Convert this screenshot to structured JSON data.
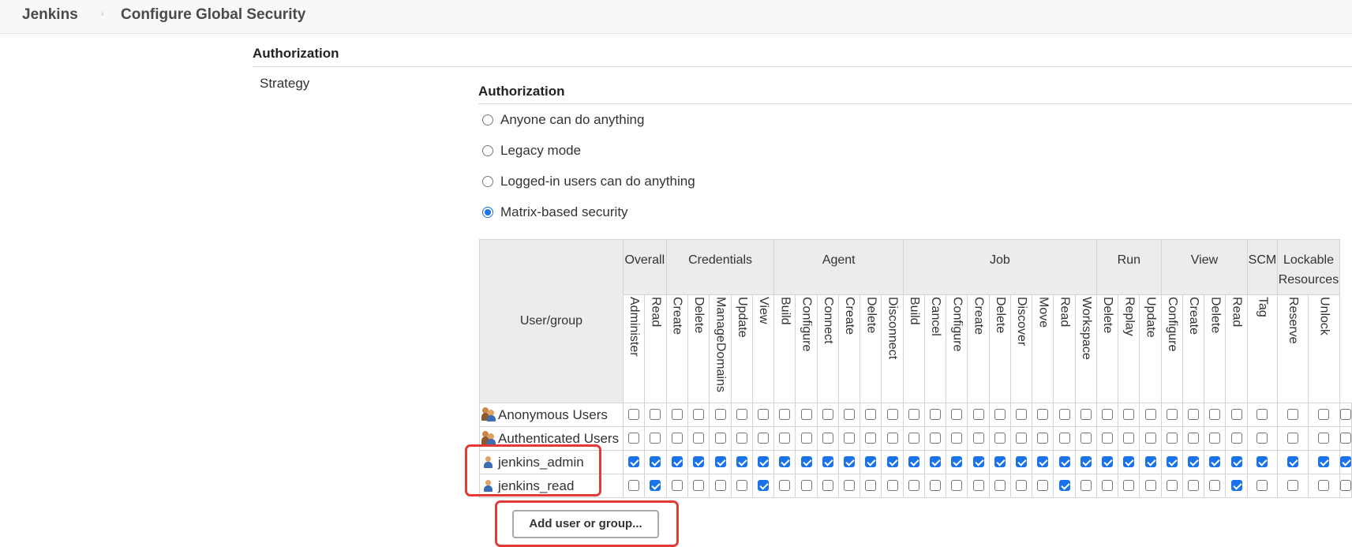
{
  "breadcrumb": {
    "home": "Jenkins",
    "separator": "›",
    "page": "Configure Global Security"
  },
  "authorization_section": {
    "title": "Authorization",
    "strategy_label": "Strategy",
    "subtitle": "Authorization"
  },
  "strategies": [
    {
      "label": "Anyone can do anything",
      "selected": false
    },
    {
      "label": "Legacy mode",
      "selected": false
    },
    {
      "label": "Logged-in users can do anything",
      "selected": false
    },
    {
      "label": "Matrix-based security",
      "selected": true
    }
  ],
  "matrix": {
    "user_group_header": "User/group",
    "groups": [
      {
        "label": "Overall",
        "permissions": [
          "Administer",
          "Read"
        ]
      },
      {
        "label": "Credentials",
        "permissions": [
          "Create",
          "Delete",
          "ManageDomains",
          "Update",
          "View"
        ]
      },
      {
        "label": "Agent",
        "permissions": [
          "Build",
          "Configure",
          "Connect",
          "Create",
          "Delete",
          "Disconnect"
        ]
      },
      {
        "label": "Job",
        "permissions": [
          "Build",
          "Cancel",
          "Configure",
          "Create",
          "Delete",
          "Discover",
          "Move",
          "Read",
          "Workspace"
        ]
      },
      {
        "label": "Run",
        "permissions": [
          "Delete",
          "Replay",
          "Update"
        ]
      },
      {
        "label": "View",
        "permissions": [
          "Configure",
          "Create",
          "Delete",
          "Read"
        ]
      },
      {
        "label": "SCM",
        "permissions": [
          "Tag"
        ]
      },
      {
        "label": "Lockable Resources",
        "permissions": [
          "Reserve",
          "Unlock"
        ]
      }
    ],
    "rows": [
      {
        "name": "Anonymous Users",
        "icon": "group-icon",
        "checked": [
          0,
          0,
          0,
          0,
          0,
          0,
          0,
          0,
          0,
          0,
          0,
          0,
          0,
          0,
          0,
          0,
          0,
          0,
          0,
          0,
          0,
          0,
          0,
          0,
          0,
          0,
          0,
          0,
          0,
          0,
          0,
          0,
          0
        ]
      },
      {
        "name": "Authenticated Users",
        "icon": "group-icon",
        "checked": [
          0,
          0,
          0,
          0,
          0,
          0,
          0,
          0,
          0,
          0,
          0,
          0,
          0,
          0,
          0,
          0,
          0,
          0,
          0,
          0,
          0,
          0,
          0,
          0,
          0,
          0,
          0,
          0,
          0,
          0,
          0,
          0,
          0
        ]
      },
      {
        "name": "jenkins_admin",
        "icon": "user-icon",
        "checked": [
          1,
          1,
          1,
          1,
          1,
          1,
          1,
          1,
          1,
          1,
          1,
          1,
          1,
          1,
          1,
          1,
          1,
          1,
          1,
          1,
          1,
          1,
          1,
          1,
          1,
          1,
          1,
          1,
          1,
          1,
          1,
          1,
          1
        ]
      },
      {
        "name": "jenkins_read",
        "icon": "user-icon",
        "checked": [
          0,
          1,
          0,
          0,
          0,
          0,
          1,
          0,
          0,
          0,
          0,
          0,
          0,
          0,
          0,
          0,
          0,
          0,
          0,
          0,
          1,
          0,
          0,
          0,
          0,
          0,
          0,
          0,
          1,
          0,
          0,
          0,
          0
        ]
      }
    ]
  },
  "add_button": "Add user or group...",
  "colors": {
    "accent": "#1a73e8",
    "highlight": "#e53935"
  }
}
